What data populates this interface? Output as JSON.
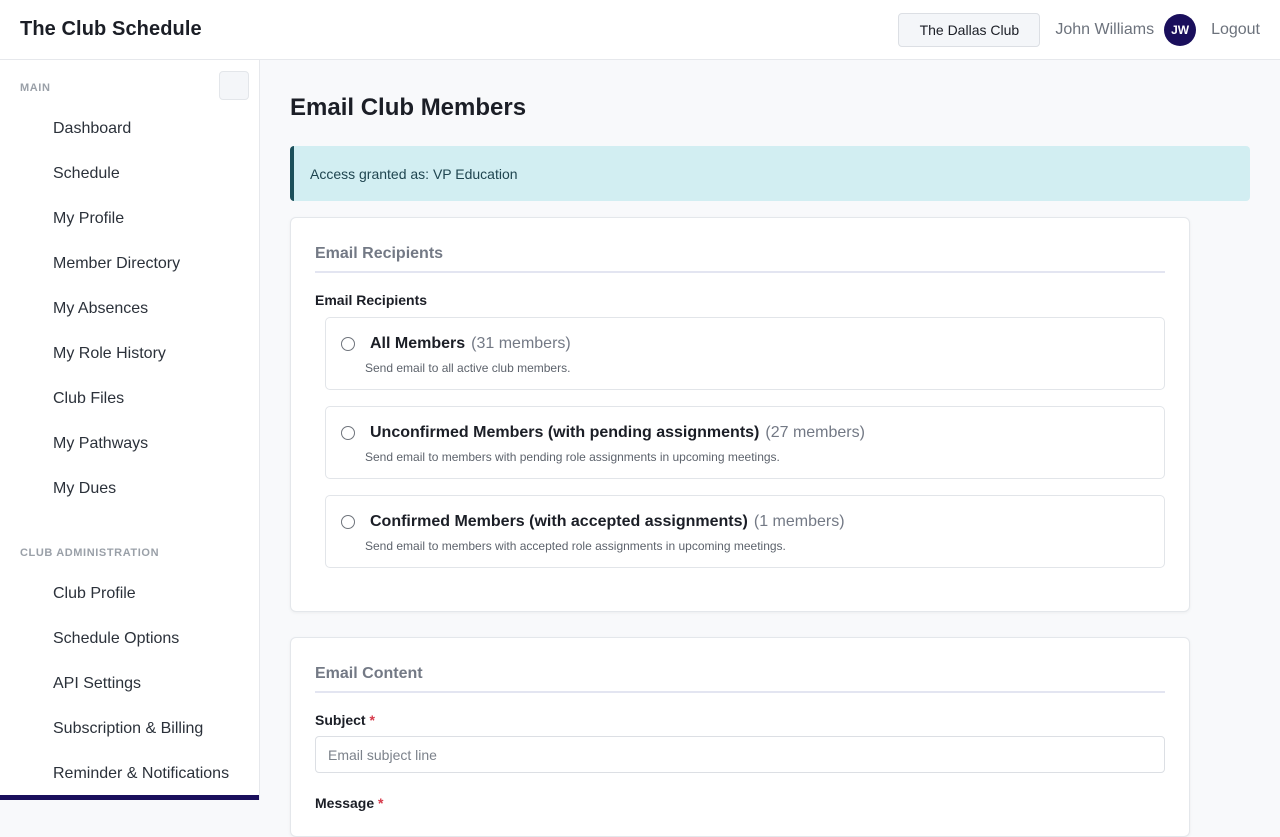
{
  "header": {
    "brand": "The Club Schedule",
    "club_button": "The Dallas Club",
    "user_name": "John Williams",
    "avatar_initials": "JW",
    "logout": "Logout"
  },
  "sidebar": {
    "main_label": "MAIN",
    "main_items": [
      {
        "label": "Dashboard"
      },
      {
        "label": "Schedule"
      },
      {
        "label": "My Profile"
      },
      {
        "label": "Member Directory"
      },
      {
        "label": "My Absences"
      },
      {
        "label": "My Role History"
      },
      {
        "label": "Club Files"
      },
      {
        "label": "My Pathways"
      },
      {
        "label": "My Dues"
      }
    ],
    "admin_label": "CLUB ADMINISTRATION",
    "admin_items": [
      {
        "label": "Club Profile"
      },
      {
        "label": "Schedule Options"
      },
      {
        "label": "API Settings"
      },
      {
        "label": "Subscription & Billing"
      },
      {
        "label": "Reminder & Notifications"
      }
    ]
  },
  "main": {
    "page_title": "Email Club Members",
    "alert_text": "Access granted as: VP Education",
    "recipients_card": {
      "title": "Email Recipients",
      "field_label": "Email Recipients",
      "options": [
        {
          "title": "All Members",
          "count": "(31 members)",
          "description": "Send email to all active club members."
        },
        {
          "title": "Unconfirmed Members (with pending assignments)",
          "count": "(27 members)",
          "description": "Send email to members with pending role assignments in upcoming meetings."
        },
        {
          "title": "Confirmed Members (with accepted assignments)",
          "count": "(1 members)",
          "description": "Send email to members with accepted role assignments in upcoming meetings."
        }
      ]
    },
    "content_card": {
      "title": "Email Content",
      "subject_label": "Subject",
      "required_mark": "*",
      "subject_placeholder": "Email subject line",
      "subject_value": "",
      "message_label": "Message"
    }
  },
  "colors": {
    "accent": "#1a0f5c",
    "alert_bg": "#d2eef2",
    "alert_border": "#1b4f5a",
    "required": "#d6394a"
  }
}
